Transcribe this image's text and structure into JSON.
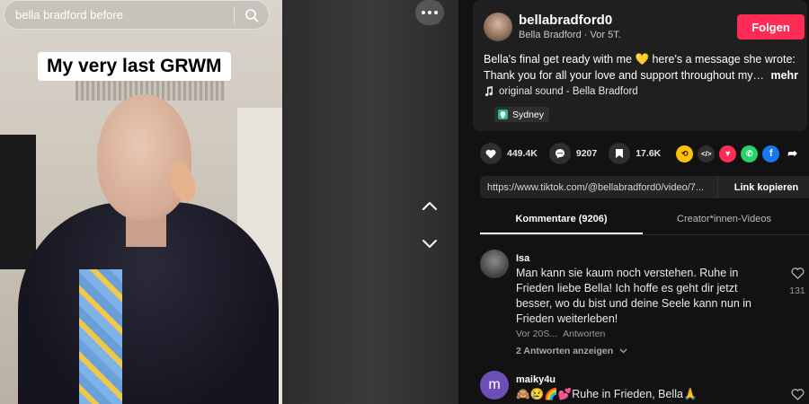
{
  "search": {
    "value": "bella bradford before",
    "icon": "search-icon"
  },
  "video": {
    "caption": "My very last GRWM"
  },
  "author": {
    "username": "bellabradford0",
    "display_name": "Bella Bradford",
    "time": "Vor 5T.",
    "follow_label": "Folgen"
  },
  "description": {
    "line1": "Bella's final get ready with me 💛 here's a message she wrote:",
    "line2": "Thank you for all your love and support throughout my…",
    "more_label": "mehr"
  },
  "sound": "original sound - Bella Bradford",
  "location": "Sydney",
  "actions": {
    "likes": "449.4K",
    "comments": "9207",
    "saves": "17.6K"
  },
  "share_link": {
    "url": "https://www.tiktok.com/@bellabradford0/video/7...",
    "copy_label": "Link kopieren"
  },
  "tabs": [
    {
      "label": "Kommentare (9206)"
    },
    {
      "label": "Creator*innen-Videos"
    }
  ],
  "comments": [
    {
      "name": "Isa",
      "text": "Man kann sie kaum noch verstehen. Ruhe in Frieden liebe Bella! Ich hoffe es geht dir jetzt besser, wo du bist und deine Seele kann nun in Frieden weiterleben!",
      "time": "Vor 20S...",
      "reply_label": "Antworten",
      "replies_label": "2 Antworten anzeigen",
      "likes": "131"
    },
    {
      "name": "maiky4u",
      "avatar_letter": "m",
      "text": "🙈😢🌈💕Ruhe in Frieden, Bella🙏"
    }
  ],
  "colors": {
    "accent": "#fe2c55",
    "panel_bg": "#121212",
    "card_bg": "#1f1f1f"
  }
}
